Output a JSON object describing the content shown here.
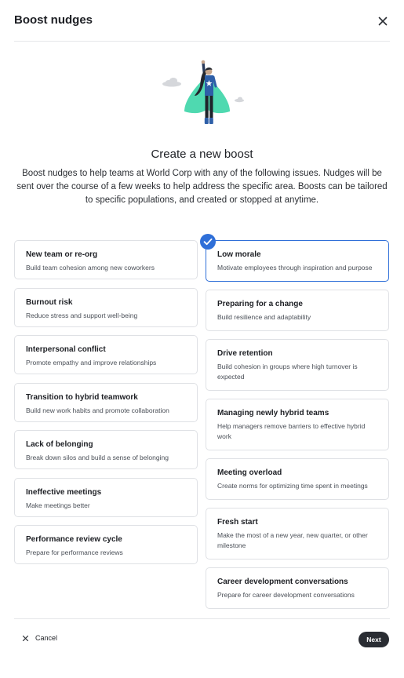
{
  "header": {
    "title": "Boost nudges"
  },
  "main": {
    "heading": "Create a new boost",
    "description": "Boost nudges to help teams at World Corp with any of the following issues. Nudges will be sent over the course of a few weeks to help address the specific area. Boosts can be tailored to specific populations, and created or stopped at anytime."
  },
  "options_left": [
    {
      "title": "New team or re-org",
      "subtitle": "Build team cohesion among new coworkers"
    },
    {
      "title": "Burnout risk",
      "subtitle": "Reduce stress and support well-being"
    },
    {
      "title": "Interpersonal conflict",
      "subtitle": "Promote empathy and improve relationships"
    },
    {
      "title": "Transition to hybrid teamwork",
      "subtitle": "Build new work habits and promote collaboration"
    },
    {
      "title": "Lack of belonging",
      "subtitle": "Break down silos and build a sense of belonging"
    },
    {
      "title": "Ineffective meetings",
      "subtitle": "Make meetings better"
    },
    {
      "title": "Performance review cycle",
      "subtitle": "Prepare for performance reviews"
    }
  ],
  "options_right": [
    {
      "title": "Low morale",
      "subtitle": "Motivate employees through inspiration and purpose",
      "selected": true
    },
    {
      "title": "Preparing for a change",
      "subtitle": "Build resilience and adaptability"
    },
    {
      "title": "Drive retention",
      "subtitle": "Build cohesion in groups where high turnover is expected"
    },
    {
      "title": "Managing newly hybrid teams",
      "subtitle": "Help managers remove barriers to effective hybrid work"
    },
    {
      "title": "Meeting overload",
      "subtitle": "Create norms for optimizing time spent in meetings"
    },
    {
      "title": "Fresh start",
      "subtitle": "Make the most of a new year, new quarter, or other milestone"
    },
    {
      "title": "Career development conversations",
      "subtitle": "Prepare for career development conversations"
    }
  ],
  "footer": {
    "cancel_label": "Cancel",
    "next_label": "Next"
  },
  "icons": {
    "close": "close-icon",
    "check": "check-icon",
    "cancel": "close-icon",
    "hero": "superhero-illustration"
  },
  "colors": {
    "accent": "#2f6fd8",
    "dark_button": "#2a2d33",
    "cape": "#4fd9b0"
  }
}
